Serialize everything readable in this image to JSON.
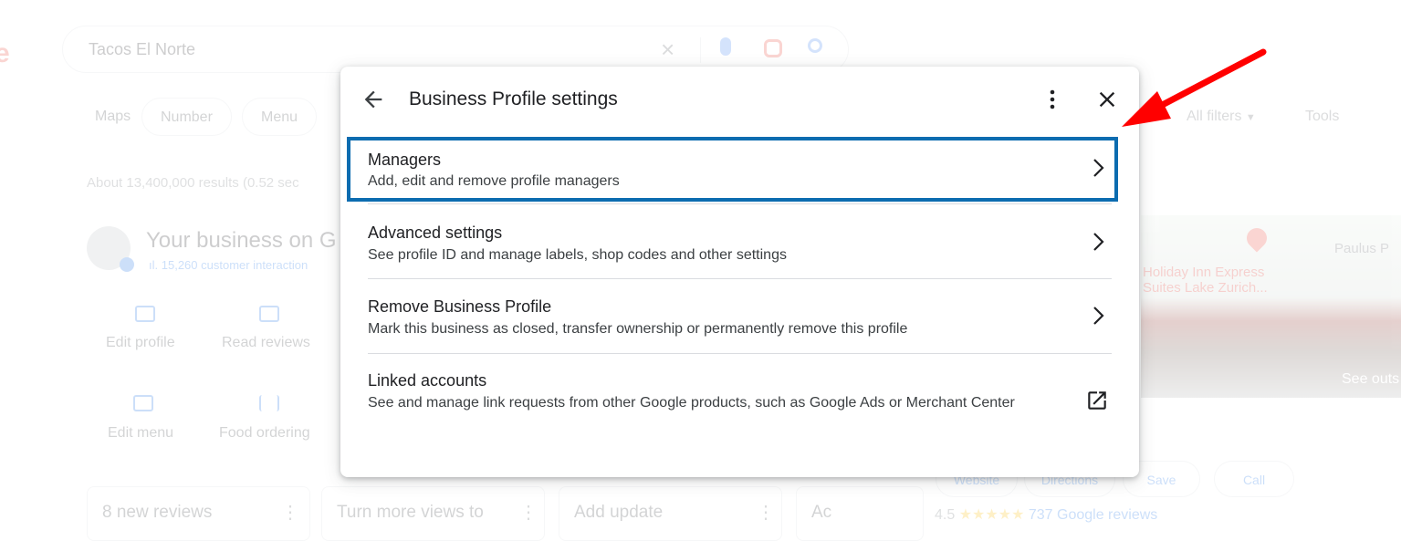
{
  "background": {
    "search": {
      "query": "Tacos El Norte"
    },
    "chips": [
      "Maps",
      "Number",
      "Menu"
    ],
    "tools": [
      "All filters",
      "Tools"
    ],
    "results_stats": "About 13,400,000 results (0.52 sec",
    "business_panel": {
      "title": "Your business on G",
      "subtitle": "15,260 customer interaction",
      "actions": [
        {
          "label": "Edit profile",
          "icon": "store-icon"
        },
        {
          "label": "Read reviews",
          "icon": "review-icon"
        },
        {
          "label": "Edit menu",
          "icon": "menu-book-icon"
        },
        {
          "label": "Food ordering",
          "icon": "utensils-icon"
        }
      ]
    },
    "cards": [
      "8 new reviews",
      "Turn more views to",
      "Add update",
      "Ac"
    ],
    "map": {
      "hotel_label_line1": "Holiday Inn Express",
      "hotel_label_line2": "Suites Lake Zurich...",
      "place_label": "Paulus P",
      "see_outside": "See outs"
    },
    "kp_buttons": [
      "Website",
      "Directions",
      "Save",
      "Call"
    ],
    "rating": {
      "score": "4.5",
      "stars": "★★★★★",
      "reviews": "737 Google reviews"
    }
  },
  "dialog": {
    "title": "Business Profile settings",
    "items": [
      {
        "title": "Managers",
        "description": "Add, edit and remove profile managers",
        "action_icon": "chevron-right-icon"
      },
      {
        "title": "Advanced settings",
        "description": "See profile ID and manage labels, shop codes and other settings",
        "action_icon": "chevron-right-icon"
      },
      {
        "title": "Remove Business Profile",
        "description": "Mark this business as closed, transfer ownership or permanently remove this profile",
        "action_icon": "chevron-right-icon"
      },
      {
        "title": "Linked accounts",
        "description": "See and manage link requests from other Google products, such as Google Ads or Merchant Center",
        "action_icon": "open-in-new-icon"
      }
    ]
  },
  "colors": {
    "highlight_box": "#0c6cb0",
    "annotation_arrow": "#ff0000"
  }
}
